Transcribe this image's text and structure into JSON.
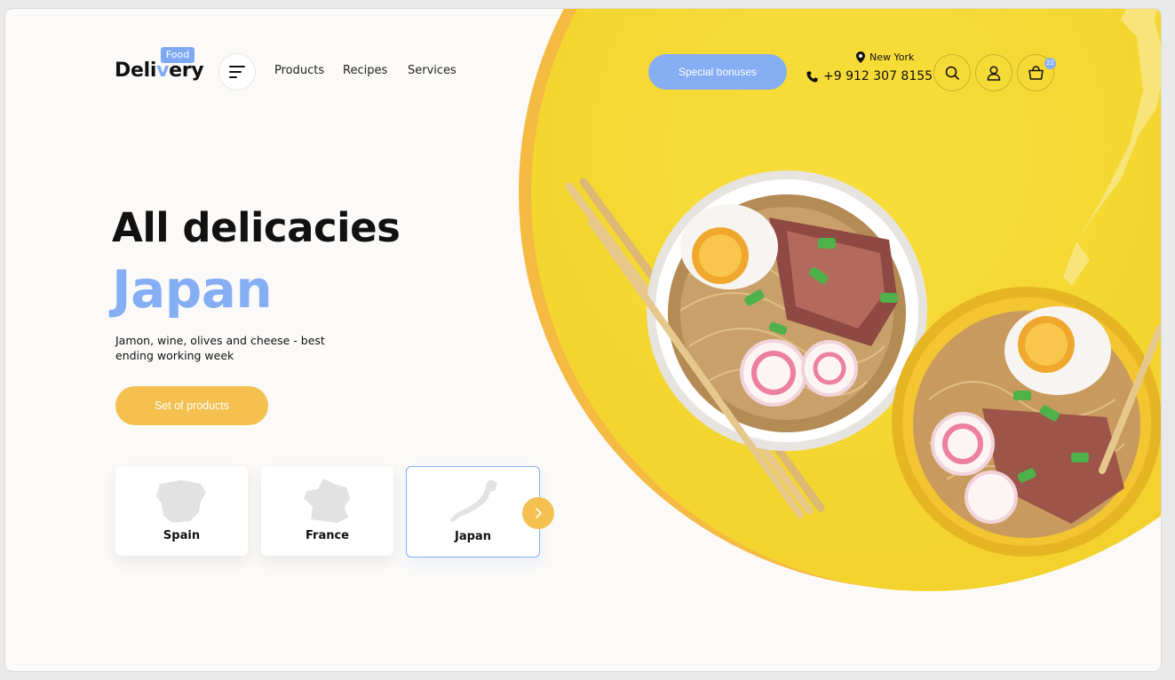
{
  "logo": {
    "badge": "Food",
    "text_before": "Deli",
    "text_accent": "v",
    "text_after": "ery"
  },
  "nav": {
    "items": [
      "Products",
      "Recipes",
      "Services"
    ]
  },
  "header": {
    "special_label": "Special bonuses",
    "location": "New York",
    "phone": "+9 912 307 8155",
    "cart_count": "22"
  },
  "hero": {
    "title": "All delicacies",
    "country": "Japan",
    "description": "Jamon, wine, olives and cheese - best ending working week",
    "cta_label": "Set of products"
  },
  "countries": [
    {
      "label": "Spain"
    },
    {
      "label": "France"
    },
    {
      "label": "Japan"
    }
  ],
  "colors": {
    "accent_blue": "#86aef5",
    "accent_yellow": "#f4c151",
    "hero_yellow": "#f4d52f"
  },
  "icons": [
    "menu-icon",
    "map-pin-icon",
    "phone-icon",
    "search-icon",
    "user-icon",
    "shopping-bag-icon",
    "chevron-right-icon"
  ]
}
